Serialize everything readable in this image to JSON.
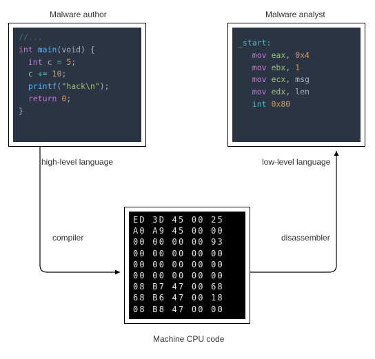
{
  "labels": {
    "author_title": "Malware author",
    "analyst_title": "Malware analyst",
    "high_level": "high-level language",
    "low_level": "low-level language",
    "compiler": "compiler",
    "disassembler": "disassembler",
    "machine": "Machine CPU code"
  },
  "c_source": {
    "comment": "//...",
    "line1_type": "int",
    "line1_func": "main",
    "line1_param": "(void) {",
    "line2_type": "int",
    "line2_var": "c",
    "line2_assign": "=",
    "line2_val": "5",
    "line3_var": "c",
    "line3_op": "+=",
    "line3_val": "10",
    "line4_func": "printf",
    "line4_str": "\"hack\\n\"",
    "line5_kw": "return",
    "line5_val": "0",
    "close": "}"
  },
  "asm": {
    "label": "_start:",
    "i1_m": "mov",
    "i1_r": "eax",
    "i1_v": "0x4",
    "i2_m": "mov",
    "i2_r": "ebx",
    "i2_v": "1",
    "i3_m": "mov",
    "i3_r": "ecx",
    "i3_v": "msg",
    "i4_m": "mov",
    "i4_r": "edx",
    "i4_v": "len",
    "i5_m": "int",
    "i5_v": "0x80"
  },
  "machine_code": {
    "r0": "ED 3D 45 00 25",
    "r1": "A0 A9 45 00 00",
    "r2": "00 00 00 00 93",
    "r3": "00 00 00 00 00",
    "r4": "00 00 00 00 00",
    "r5": "00 00 00 00 00",
    "r6": "08 B7 47 00 68",
    "r7": "68 B6 47 00 18",
    "r8": "08 B8 47 00 00"
  },
  "chart_data": {
    "type": "diagram",
    "nodes": [
      {
        "id": "author",
        "title": "Malware author",
        "body": "C source code (int main / printf)",
        "note": "high-level language"
      },
      {
        "id": "machine",
        "title": "Machine CPU code",
        "body": "raw hex bytes grid"
      },
      {
        "id": "analyst",
        "title": "Malware analyst",
        "body": "x86 assembly listing (_start / mov / int 0x80)",
        "note": "low-level language"
      }
    ],
    "edges": [
      {
        "from": "author",
        "to": "machine",
        "label": "compiler"
      },
      {
        "from": "machine",
        "to": "analyst",
        "label": "disassembler"
      }
    ]
  }
}
